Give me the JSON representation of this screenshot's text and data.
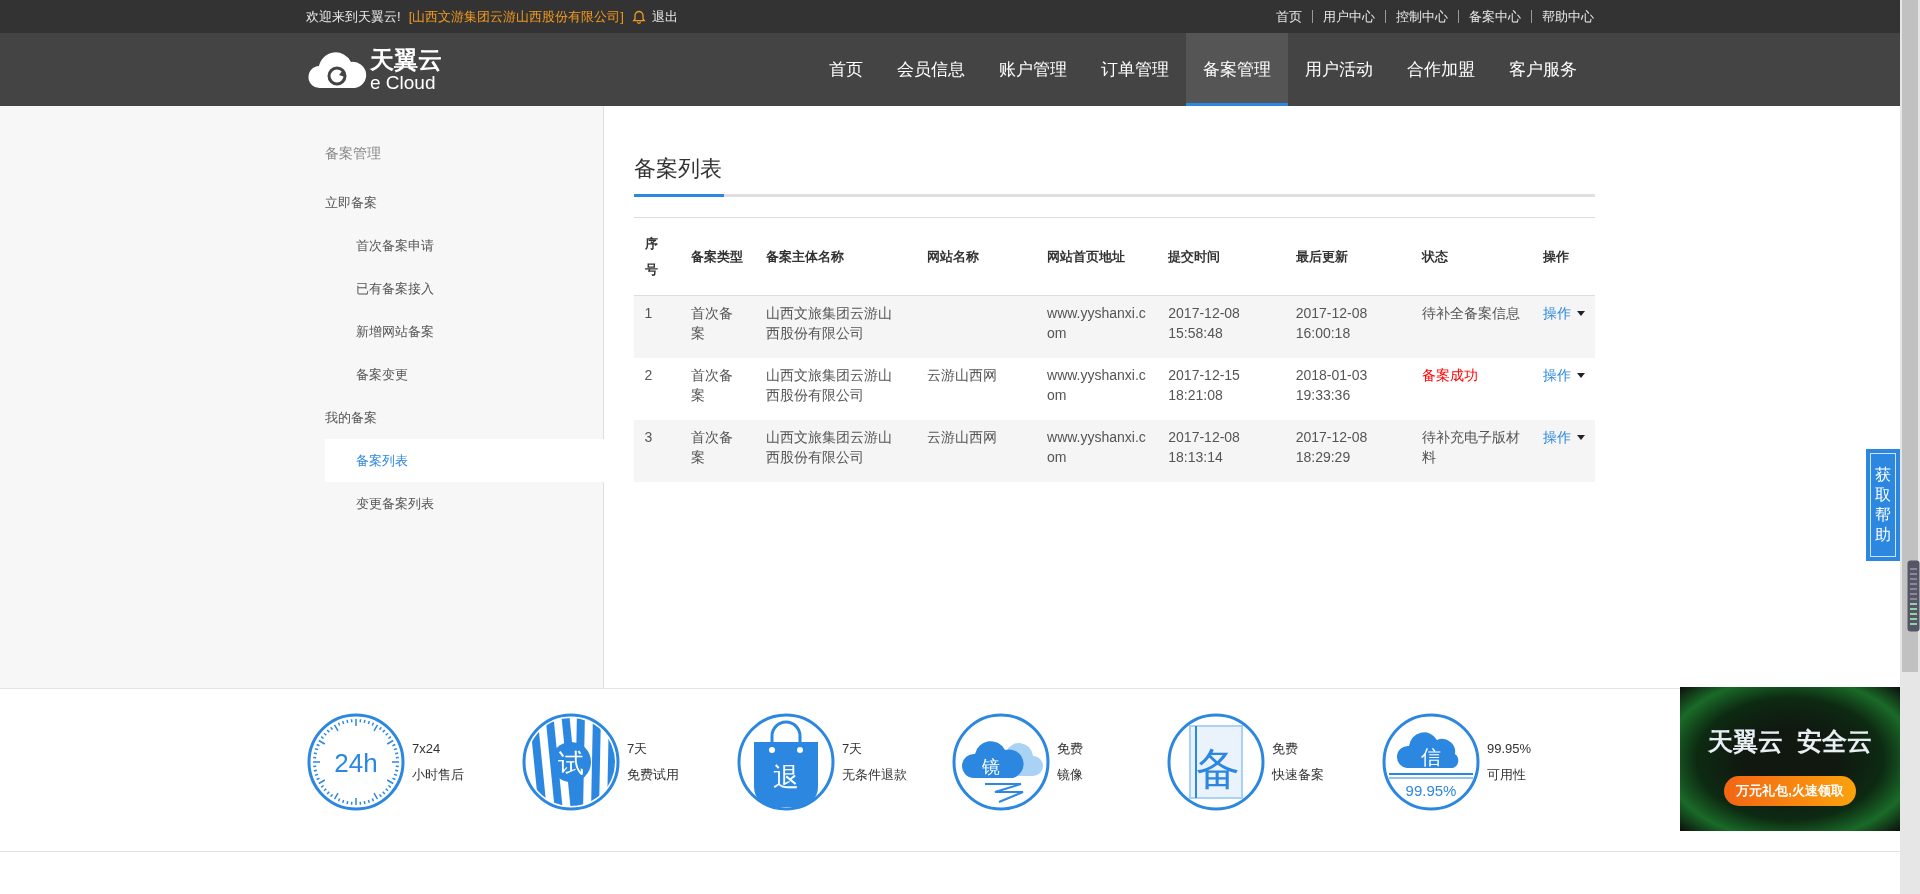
{
  "top_bar": {
    "greeting": "欢迎来到天翼云!",
    "company": "[山西文游集团云游山西股份有限公司]",
    "logout": "退出",
    "links": [
      "首页",
      "用户中心",
      "控制中心",
      "备案中心",
      "帮助中心"
    ]
  },
  "nav": {
    "logo": {
      "name": "天翼云",
      "sub": "e Cloud"
    },
    "items": [
      {
        "label": "首页",
        "selected": false
      },
      {
        "label": "会员信息",
        "selected": false
      },
      {
        "label": "账户管理",
        "selected": false
      },
      {
        "label": "订单管理",
        "selected": false
      },
      {
        "label": "备案管理",
        "selected": true
      },
      {
        "label": "用户活动",
        "selected": false
      },
      {
        "label": "合作加盟",
        "selected": false
      },
      {
        "label": "客户服务",
        "selected": false
      }
    ]
  },
  "sidebar": {
    "title": "备案管理",
    "groups": [
      {
        "label": "立即备案",
        "items": [
          {
            "label": "首次备案申请",
            "selected": false
          },
          {
            "label": "已有备案接入",
            "selected": false
          },
          {
            "label": "新增网站备案",
            "selected": false
          },
          {
            "label": "备案变更",
            "selected": false
          }
        ]
      },
      {
        "label": "我的备案",
        "items": [
          {
            "label": "备案列表",
            "selected": true
          },
          {
            "label": "变更备案列表",
            "selected": false
          }
        ]
      }
    ]
  },
  "page": {
    "title": "备案列表",
    "table": {
      "columns": [
        "序号",
        "备案类型",
        "备案主体名称",
        "网站名称",
        "网站首页地址",
        "提交时间",
        "最后更新",
        "状态",
        "操作"
      ],
      "rows": [
        {
          "cells": [
            "1",
            "首次备案",
            "山西文旅集团云游山西股份有限公司",
            "",
            "www.yyshanxi.com",
            "2017-12-08 15:58:48",
            "2017-12-08 16:00:18"
          ],
          "status": "待补全备案信息",
          "success": false,
          "action": "操作"
        },
        {
          "cells": [
            "2",
            "首次备案",
            "山西文旅集团云游山西股份有限公司",
            "云游山西网",
            "www.yyshanxi.com",
            "2017-12-15 18:21:08",
            "2018-01-03 19:33:36"
          ],
          "status": "备案成功",
          "success": true,
          "action": "操作"
        },
        {
          "cells": [
            "3",
            "首次备案",
            "山西文旅集团云游山西股份有限公司",
            "云游山西网",
            "www.yyshanxi.com",
            "2017-12-08 18:13:14",
            "2017-12-08 18:29:29"
          ],
          "status": "待补充电子版材料",
          "success": false,
          "action": "操作"
        }
      ]
    }
  },
  "features": [
    {
      "kind": "clock",
      "badge": "24h",
      "line1": "7x24",
      "line2": "小时售后"
    },
    {
      "kind": "stripes",
      "badge": "试",
      "line1": "7天",
      "line2": "免费试用"
    },
    {
      "kind": "bag",
      "badge": "退",
      "line1": "7天",
      "line2": "无条件退款"
    },
    {
      "kind": "cloud",
      "badge": "镜",
      "line1": "免费",
      "line2": "镜像"
    },
    {
      "kind": "doc",
      "badge": "备",
      "line1": "免费",
      "line2": "快速备案"
    },
    {
      "kind": "shield",
      "badge": "信",
      "badge_sub": "99.95%",
      "line1": "99.95%",
      "line2": "可用性"
    }
  ],
  "help_tab": {
    "label": "获取帮助"
  },
  "ad": {
    "headline": [
      "天翼云",
      "安全云"
    ],
    "button": "万元礼包,火速领取"
  }
}
